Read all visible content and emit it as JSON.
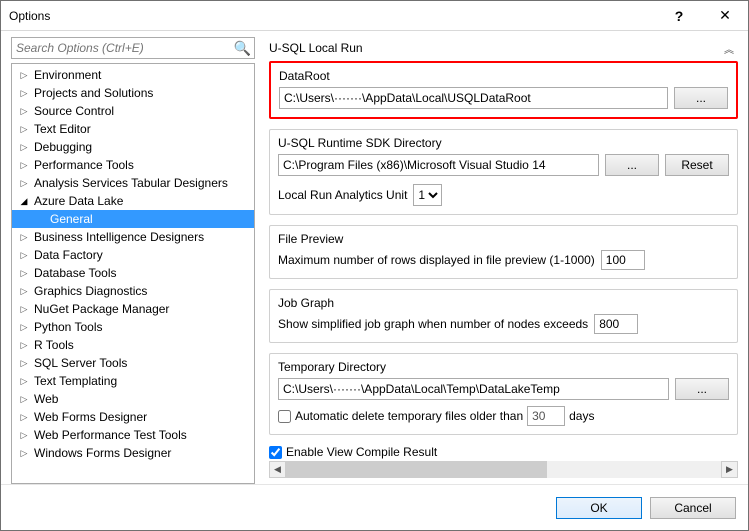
{
  "window": {
    "title": "Options"
  },
  "search": {
    "placeholder": "Search Options (Ctrl+E)"
  },
  "tree": [
    {
      "label": "Environment",
      "depth": 0,
      "expanded": false,
      "selected": false
    },
    {
      "label": "Projects and Solutions",
      "depth": 0,
      "expanded": false,
      "selected": false
    },
    {
      "label": "Source Control",
      "depth": 0,
      "expanded": false,
      "selected": false
    },
    {
      "label": "Text Editor",
      "depth": 0,
      "expanded": false,
      "selected": false
    },
    {
      "label": "Debugging",
      "depth": 0,
      "expanded": false,
      "selected": false
    },
    {
      "label": "Performance Tools",
      "depth": 0,
      "expanded": false,
      "selected": false
    },
    {
      "label": "Analysis Services Tabular Designers",
      "depth": 0,
      "expanded": false,
      "selected": false
    },
    {
      "label": "Azure Data Lake",
      "depth": 0,
      "expanded": true,
      "selected": false
    },
    {
      "label": "General",
      "depth": 1,
      "expanded": false,
      "selected": true
    },
    {
      "label": "Business Intelligence Designers",
      "depth": 0,
      "expanded": false,
      "selected": false
    },
    {
      "label": "Data Factory",
      "depth": 0,
      "expanded": false,
      "selected": false
    },
    {
      "label": "Database Tools",
      "depth": 0,
      "expanded": false,
      "selected": false
    },
    {
      "label": "Graphics Diagnostics",
      "depth": 0,
      "expanded": false,
      "selected": false
    },
    {
      "label": "NuGet Package Manager",
      "depth": 0,
      "expanded": false,
      "selected": false
    },
    {
      "label": "Python Tools",
      "depth": 0,
      "expanded": false,
      "selected": false
    },
    {
      "label": "R Tools",
      "depth": 0,
      "expanded": false,
      "selected": false
    },
    {
      "label": "SQL Server Tools",
      "depth": 0,
      "expanded": false,
      "selected": false
    },
    {
      "label": "Text Templating",
      "depth": 0,
      "expanded": false,
      "selected": false
    },
    {
      "label": "Web",
      "depth": 0,
      "expanded": false,
      "selected": false
    },
    {
      "label": "Web Forms Designer",
      "depth": 0,
      "expanded": false,
      "selected": false
    },
    {
      "label": "Web Performance Test Tools",
      "depth": 0,
      "expanded": false,
      "selected": false
    },
    {
      "label": "Windows Forms Designer",
      "depth": 0,
      "expanded": false,
      "selected": false
    }
  ],
  "panel": {
    "heading": "U-SQL Local Run",
    "dataroot": {
      "title": "DataRoot",
      "value": "C:\\Users\\·······\\AppData\\Local\\USQLDataRoot",
      "browse": "..."
    },
    "runtime": {
      "title": "U-SQL Runtime SDK Directory",
      "value": "C:\\Program Files (x86)\\Microsoft Visual Studio 14",
      "browse": "...",
      "reset": "Reset",
      "analytics_label": "Local Run Analytics Unit",
      "analytics_value": "1"
    },
    "preview": {
      "title": "File Preview",
      "label": "Maximum number of rows displayed in file preview (1-1000)",
      "value": "100"
    },
    "jobgraph": {
      "title": "Job Graph",
      "label": "Show simplified job graph when number of nodes exceeds",
      "value": "800"
    },
    "tempdir": {
      "title": "Temporary Directory",
      "value": "C:\\Users\\·······\\AppData\\Local\\Temp\\DataLakeTemp",
      "browse": "...",
      "auto_label_pre": "Automatic delete temporary files older than",
      "auto_value": "30",
      "auto_label_post": "days",
      "auto_checked": false
    },
    "enable_compile": {
      "label": "Enable View Compile Result",
      "checked": true
    }
  },
  "buttons": {
    "ok": "OK",
    "cancel": "Cancel"
  }
}
